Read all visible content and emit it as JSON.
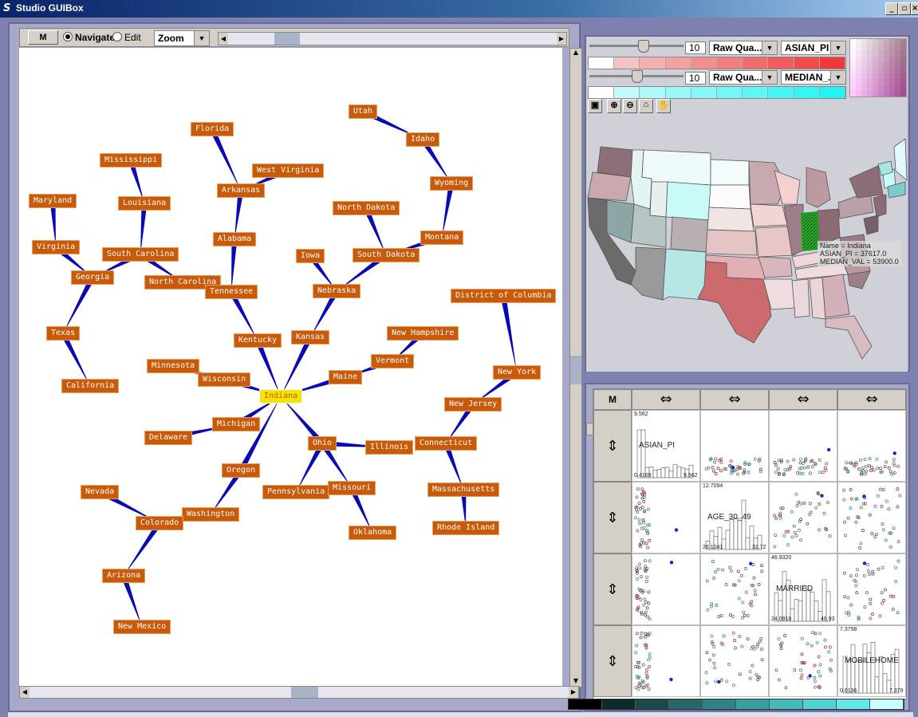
{
  "window": {
    "title": "Studio GUIBox",
    "logo_glyph": "S",
    "min": "_",
    "max": "▫",
    "close": "×"
  },
  "graph_toolbar": {
    "m_label": "M",
    "navigate_label": "Navigate",
    "edit_label": "Edit",
    "mode_selected": "Navigate",
    "zoom_label": "Zoom"
  },
  "graph": {
    "selected": "Indiana",
    "nodes": [
      {
        "label": "Utah"
      },
      {
        "label": "Idaho"
      },
      {
        "label": "Wyoming"
      },
      {
        "label": "Montana"
      },
      {
        "label": "Florida"
      },
      {
        "label": "West Virginia"
      },
      {
        "label": "Arkansas"
      },
      {
        "label": "Alabama"
      },
      {
        "label": "Mississippi"
      },
      {
        "label": "Louisiana"
      },
      {
        "label": "Maryland"
      },
      {
        "label": "Virginia"
      },
      {
        "label": "South Carolina"
      },
      {
        "label": "North Carolina"
      },
      {
        "label": "Georgia"
      },
      {
        "label": "Texas"
      },
      {
        "label": "California"
      },
      {
        "label": "Tennessee"
      },
      {
        "label": "Kentucky"
      },
      {
        "label": "North Dakota"
      },
      {
        "label": "South Dakota"
      },
      {
        "label": "Iowa"
      },
      {
        "label": "Nebraska"
      },
      {
        "label": "Kansas"
      },
      {
        "label": "District of Columbia"
      },
      {
        "label": "New Hampshire"
      },
      {
        "label": "Vermont"
      },
      {
        "label": "Minnesota"
      },
      {
        "label": "Wisconsin"
      },
      {
        "label": "Maine"
      },
      {
        "label": "Indiana"
      },
      {
        "label": "New York"
      },
      {
        "label": "New Jersey"
      },
      {
        "label": "Michigan"
      },
      {
        "label": "Delaware"
      },
      {
        "label": "Ohio"
      },
      {
        "label": "Illinois"
      },
      {
        "label": "Connecticut"
      },
      {
        "label": "Oregon"
      },
      {
        "label": "Pennsylvania"
      },
      {
        "label": "Missouri"
      },
      {
        "label": "Massachusetts"
      },
      {
        "label": "Nevada"
      },
      {
        "label": "Washington"
      },
      {
        "label": "Colorado"
      },
      {
        "label": "Rhode Island"
      },
      {
        "label": "Oklahoma"
      },
      {
        "label": "Arizona"
      },
      {
        "label": "New Mexico"
      }
    ]
  },
  "map_controls": {
    "row1": {
      "slider_value": "10",
      "classification": "Raw Qua...",
      "variable": "ASIAN_PI",
      "slider_fraction": 0.55
    },
    "row2": {
      "slider_value": "10",
      "classification": "Raw Qua...",
      "variable": "MEDIAN_...",
      "slider_fraction": 0.48
    },
    "colors": {
      "row1_light": "#f4d4d4",
      "row1_dark": "#f03a3a",
      "row2_light": "#d8fafa",
      "row2_dark": "#22f4f4"
    },
    "tools": [
      "select-icon",
      "zoom-in-icon",
      "zoom-out-icon",
      "home-icon",
      "pan-icon"
    ]
  },
  "map": {
    "tooltip_name": "Name = Indiana",
    "tooltip_asian": "ASIAN_PI = 37617.0",
    "tooltip_median": "MEDIAN_VAL = 53900.0",
    "highlight_color": "#1aa01a"
  },
  "spm": {
    "m_label": "M",
    "col_arrow": "⇔",
    "row_arrow": "⇕",
    "variables": [
      "ASIAN_PI",
      "AGE_30_49",
      "MARRIED",
      "MOBILEHOME"
    ],
    "diag_min": [
      "0.4169",
      "26.1041",
      "24.0918",
      "0.6136"
    ],
    "diag_max": [
      "9.562",
      "12.7094",
      "46.9320",
      "7.3798"
    ],
    "diag_max_bottom": [
      "9.562",
      "32.72",
      "46.93",
      "7.379"
    ]
  }
}
